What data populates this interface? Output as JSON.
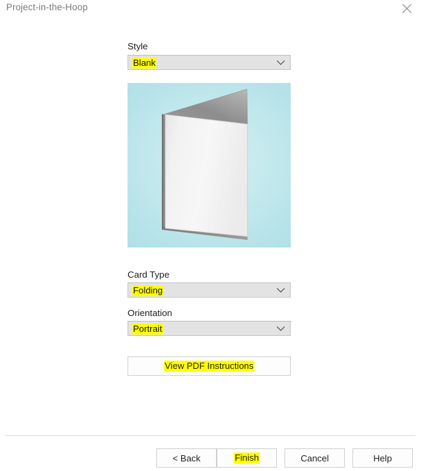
{
  "window": {
    "title": "Project-in-the-Hoop",
    "close_icon": "close-icon"
  },
  "form": {
    "style": {
      "label": "Style",
      "value": "Blank",
      "highlighted": true,
      "arrow_icon": "chevron-down-icon"
    },
    "card_type": {
      "label": "Card Type",
      "value": "Folding",
      "highlighted": true,
      "arrow_icon": "chevron-down-icon"
    },
    "orientation": {
      "label": "Orientation",
      "value": "Portrait",
      "highlighted": true,
      "arrow_icon": "chevron-down-icon"
    }
  },
  "preview": {
    "alt": "folded blank portrait greeting card",
    "background_color": "#bfe8ec"
  },
  "actions": {
    "view_pdf": "View PDF Instructions"
  },
  "footer": {
    "back": "< Back",
    "finish": "Finish",
    "cancel": "Cancel",
    "help": "Help"
  },
  "colors": {
    "highlight": "#ffff00",
    "title_text": "#7b7b7b",
    "combo_background": "#e3e3e3",
    "button_background": "#fdfdfd",
    "separator": "#dcdcdc"
  }
}
